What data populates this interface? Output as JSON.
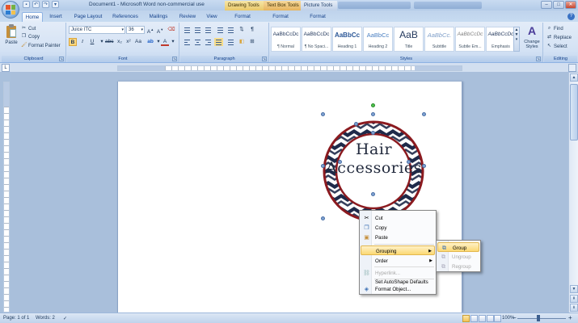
{
  "window": {
    "title": "Document1 - Microsoft Word non-commercial use",
    "contextual_tabs": [
      "Drawing Tools",
      "Text Box Tools",
      "Picture Tools"
    ]
  },
  "tabs": [
    "Home",
    "Insert",
    "Page Layout",
    "References",
    "Mailings",
    "Review",
    "View",
    "Format",
    "Format",
    "Format"
  ],
  "clipboard": {
    "paste": "Paste",
    "cut": "Cut",
    "copy": "Copy",
    "format_painter": "Format Painter",
    "group_label": "Clipboard"
  },
  "font": {
    "name": "Juice ITC",
    "size": "36",
    "group_label": "Font"
  },
  "paragraph": {
    "group_label": "Paragraph"
  },
  "styles": {
    "group_label": "Styles",
    "items": [
      {
        "sample": "AaBbCcDc",
        "name": "¶ Normal"
      },
      {
        "sample": "AaBbCcDc",
        "name": "¶ No Spaci..."
      },
      {
        "sample": "AaBbCc",
        "name": "Heading 1"
      },
      {
        "sample": "AaBbCc",
        "name": "Heading 2"
      },
      {
        "sample": "AaB",
        "name": "Title"
      },
      {
        "sample": "AaBbCc.",
        "name": "Subtitle"
      },
      {
        "sample": "AaBbCcDc",
        "name": "Subtle Em..."
      },
      {
        "sample": "AaBbCcDc",
        "name": "Emphasis"
      }
    ],
    "change_styles": "Change Styles"
  },
  "editing": {
    "group_label": "Editing",
    "find": "Find",
    "replace": "Replace",
    "select": "Select"
  },
  "graphic": {
    "line1": "Hair",
    "line2": "Accessories",
    "ring_color": "#8b1a1f",
    "chevron_color": "#1f2a4a"
  },
  "context_menu": {
    "items": [
      {
        "label": "Cut",
        "icon": "scissors-icon"
      },
      {
        "label": "Copy",
        "icon": "copy-icon"
      },
      {
        "label": "Paste",
        "icon": "paste-icon"
      },
      {
        "label": "Grouping",
        "icon": ""
      },
      {
        "label": "Order",
        "icon": ""
      },
      {
        "label": "Hyperlink...",
        "icon": "hyperlink-icon"
      },
      {
        "label": "Set AutoShape Defaults",
        "icon": ""
      },
      {
        "label": "Format Object...",
        "icon": "format-icon"
      }
    ]
  },
  "submenu": {
    "items": [
      {
        "label": "Group",
        "icon": "group-icon"
      },
      {
        "label": "Ungroup",
        "icon": "ungroup-icon"
      },
      {
        "label": "Regroup",
        "icon": "regroup-icon"
      }
    ]
  },
  "status": {
    "page": "Page: 1 of 1",
    "words": "Words: 2",
    "zoom": "100%"
  }
}
